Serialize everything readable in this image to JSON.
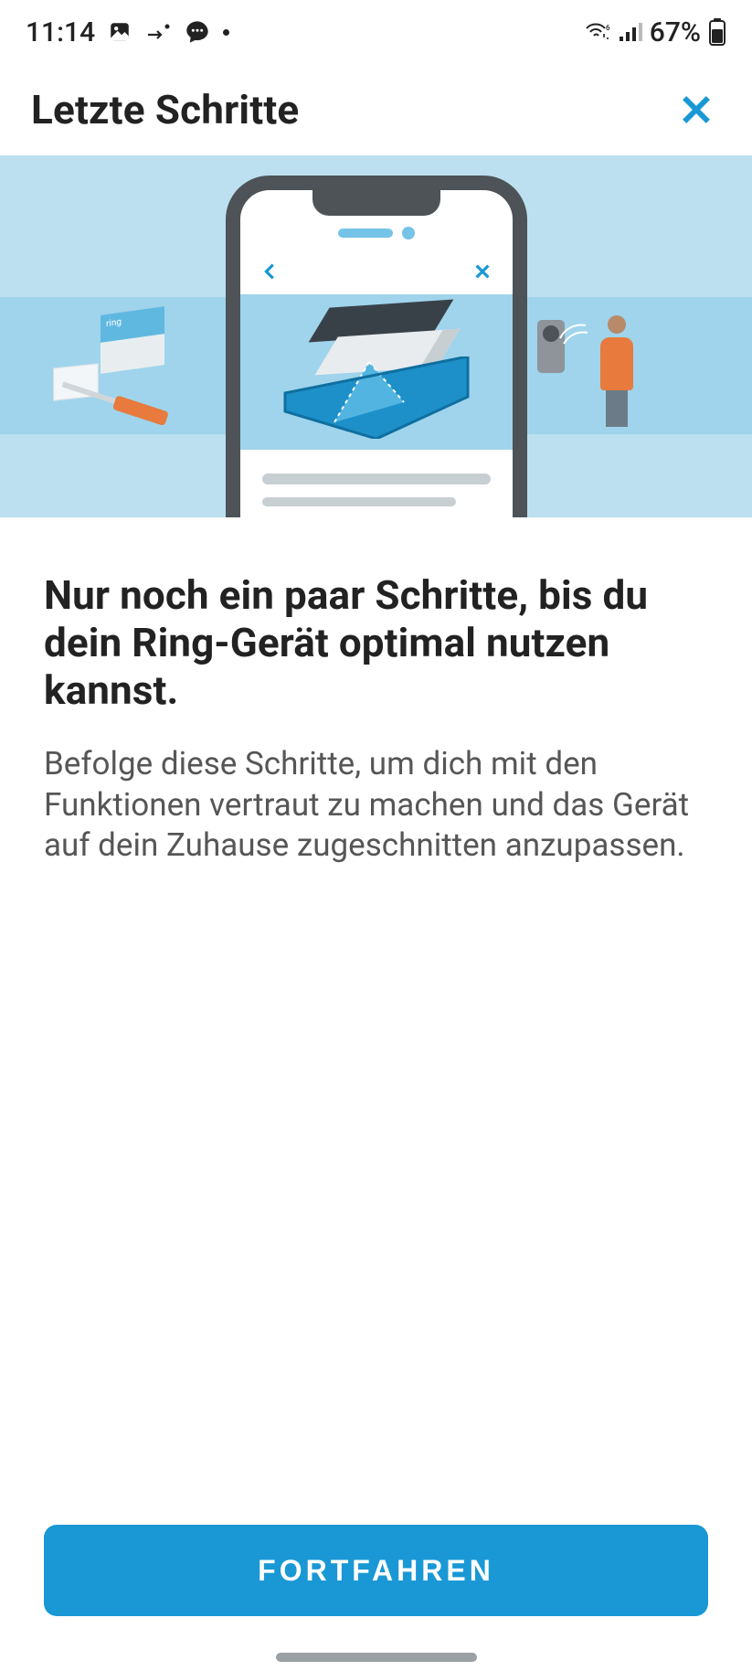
{
  "status": {
    "time": "11:14",
    "battery_text": "67%"
  },
  "header": {
    "title": "Letzte Schritte"
  },
  "illustration": {
    "ring_box_label": "ring"
  },
  "content": {
    "heading": "Nur noch ein paar Schritte, bis du dein Ring-Gerät optimal nutzen kannst.",
    "body": "Befolge diese Schritte, um dich mit den Funktionen vertraut zu machen und das Gerät auf dein Zuhause zugeschnitten anzupassen."
  },
  "footer": {
    "continue_label": "FORTFAHREN"
  },
  "colors": {
    "accent": "#1998d5",
    "hero_bg": "#bce0f0",
    "hero_band": "#9fd4ec"
  }
}
